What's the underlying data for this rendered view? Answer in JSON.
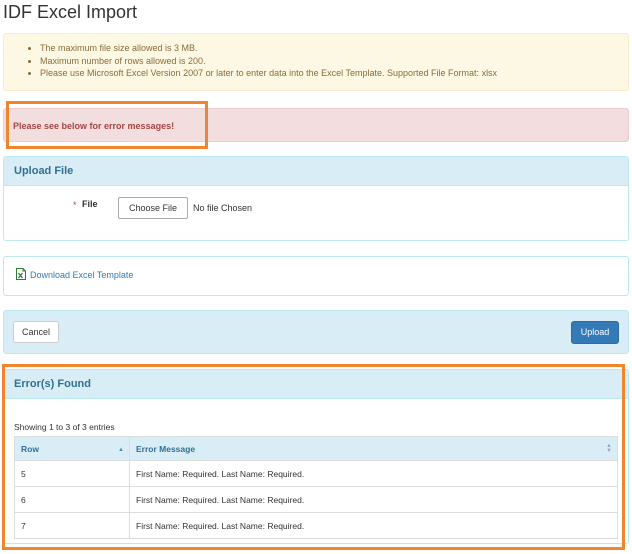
{
  "page": {
    "title": "IDF Excel Import"
  },
  "info": {
    "items": [
      "The maximum file size allowed is 3 MB.",
      "Maximum number of rows allowed is 200.",
      "Please use Microsoft Excel Version 2007 or later to enter data into the Excel Template. Supported File Format: xlsx"
    ]
  },
  "alert": {
    "text": "Please see below for error messages!"
  },
  "upload_panel": {
    "heading": "Upload File",
    "required_mark": "*",
    "file_label": "File",
    "choose_button": "Choose File",
    "no_file_text": "No file Chosen"
  },
  "download": {
    "icon": "excel-file-icon",
    "link": "Download Excel Template"
  },
  "actions": {
    "cancel": "Cancel",
    "upload": "Upload"
  },
  "errors": {
    "heading": "Error(s) Found",
    "showing": "Showing 1 to 3 of 3 entries",
    "columns": [
      "Row",
      "Error Message"
    ],
    "rows": [
      {
        "row": "5",
        "message": "First Name: Required. Last Name: Required."
      },
      {
        "row": "6",
        "message": "First Name: Required. Last Name: Required."
      },
      {
        "row": "7",
        "message": "First Name: Required. Last Name: Required."
      }
    ]
  },
  "colors": {
    "highlight": "#f0852e",
    "panel_header": "#d9edf7",
    "primary_button": "#337ab7",
    "error_alert": "#f2dede",
    "info_box": "#fcf8e3"
  }
}
